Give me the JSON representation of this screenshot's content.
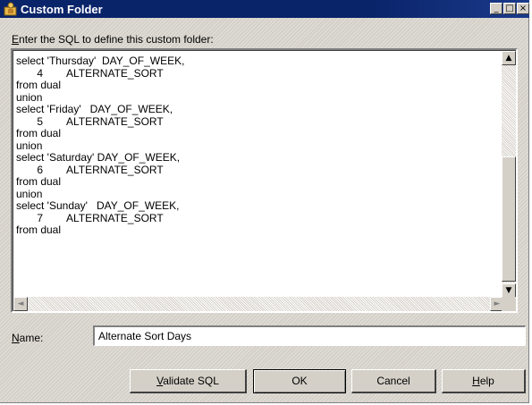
{
  "window": {
    "title": "Custom Folder",
    "minimize_glyph": "_",
    "maximize_glyph": "□",
    "close_glyph": "×"
  },
  "sql": {
    "label_mnemonic": "E",
    "label_rest": "nter the SQL to define this custom folder:",
    "text": "select 'Thursday'  DAY_OF_WEEK,\n       4        ALTERNATE_SORT\nfrom dual\nunion\nselect 'Friday'   DAY_OF_WEEK,\n       5        ALTERNATE_SORT\nfrom dual\nunion\nselect 'Saturday' DAY_OF_WEEK,\n       6        ALTERNATE_SORT\nfrom dual\nunion\nselect 'Sunday'   DAY_OF_WEEK,\n       7        ALTERNATE_SORT\nfrom dual"
  },
  "scroll": {
    "up": "▲",
    "down": "▼",
    "left": "◄",
    "right": "►"
  },
  "name_field": {
    "label_mnemonic": "N",
    "label_rest": "ame:",
    "value": "Alternate Sort Days"
  },
  "buttons": {
    "validate_mnemonic": "V",
    "validate_rest": "alidate SQL",
    "ok": "OK",
    "cancel": "Cancel",
    "help_mnemonic": "H",
    "help_rest": "elp"
  },
  "colors": {
    "titlebar": "#0a246a",
    "face": "#d4d0c8"
  },
  "icons": {
    "title": "folder-person-icon"
  }
}
